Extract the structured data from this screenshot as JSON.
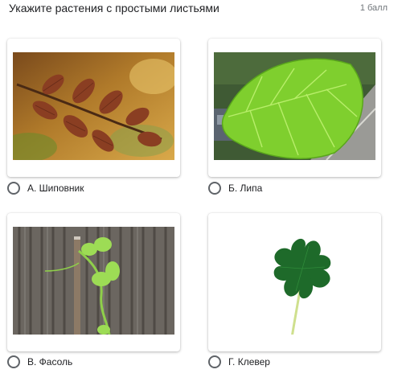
{
  "question": {
    "title": "Укажите растения с простыми листьями",
    "points": "1 балл"
  },
  "options": [
    {
      "label": "А. Шиповник",
      "image": "rosehip-leaves-autumn",
      "selected": false
    },
    {
      "label": "Б. Липа",
      "image": "linden-leaf",
      "selected": false
    },
    {
      "label": "В. Фасоль",
      "image": "bean-seedling",
      "selected": false
    },
    {
      "label": "Г. Клевер",
      "image": "clover-leaf",
      "selected": false
    }
  ]
}
